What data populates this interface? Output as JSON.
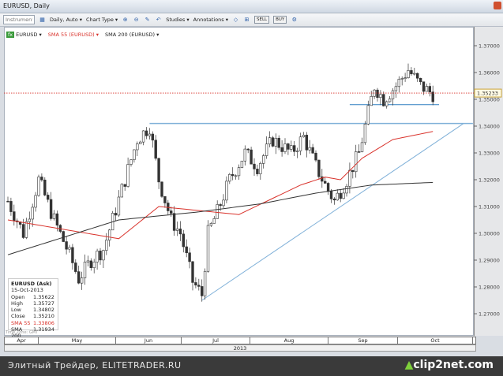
{
  "window": {
    "title": "EURUSD, Daily"
  },
  "toolbar": {
    "instrument_placeholder": "Instrument",
    "period": "Daily, Auto ▾",
    "chart_type": "Chart Type ▾",
    "studies": "Studies ▾",
    "annotations": "Annotations ▾",
    "sell": "SELL",
    "buy": "BUY"
  },
  "legend": {
    "symbol": "EURUSD ▾",
    "sma55": "SMA 55 (EURUSD) ▾",
    "sma200": "SMA 200 (EURUSD) ▾"
  },
  "info": {
    "title": "EURUSD (Ask)",
    "date": "15-Oct-2013",
    "rows": [
      [
        "Open",
        "1.35622"
      ],
      [
        "High",
        "1.35727"
      ],
      [
        "Low",
        "1.34802"
      ],
      [
        "Close",
        "1.35210"
      ],
      [
        "SMA 55",
        "1.33806"
      ],
      [
        "SMA 200",
        "1.31934"
      ]
    ]
  },
  "time_zone": "Time Zone: GMT",
  "colors": {
    "sma55": "#d9322b",
    "sma200": "#333333",
    "trend": "#5b9bd5",
    "current": "#d9322b"
  },
  "chart_data": {
    "type": "candlestick",
    "symbol": "EURUSD",
    "timeframe": "Daily",
    "months": [
      "Apr",
      "May",
      "Jun",
      "Jul",
      "Aug",
      "Sep",
      "Oct"
    ],
    "year": "2013",
    "y_ticks": [
      "1.37000",
      "1.36000",
      "1.35000",
      "1.34000",
      "1.33000",
      "1.32000",
      "1.31000",
      "1.30000",
      "1.29000",
      "1.28000",
      "1.27000"
    ],
    "ylim": [
      1.262,
      1.378
    ],
    "current_price": "1.35233",
    "days": 138,
    "close_path": [
      [
        0,
        1.312
      ],
      [
        5,
        1.3
      ],
      [
        10,
        1.32
      ],
      [
        15,
        1.305
      ],
      [
        20,
        1.292
      ],
      [
        23,
        1.283
      ],
      [
        27,
        1.29
      ],
      [
        31,
        1.294
      ],
      [
        38,
        1.32
      ],
      [
        42,
        1.335
      ],
      [
        46,
        1.34
      ],
      [
        49,
        1.32
      ],
      [
        53,
        1.305
      ],
      [
        56,
        1.3
      ],
      [
        60,
        1.282
      ],
      [
        63,
        1.277
      ],
      [
        65,
        1.3
      ],
      [
        68,
        1.308
      ],
      [
        72,
        1.32
      ],
      [
        77,
        1.33
      ],
      [
        81,
        1.325
      ],
      [
        86,
        1.335
      ],
      [
        92,
        1.33
      ],
      [
        96,
        1.336
      ],
      [
        100,
        1.325
      ],
      [
        103,
        1.318
      ],
      [
        106,
        1.312
      ],
      [
        110,
        1.32
      ],
      [
        114,
        1.33
      ],
      [
        117,
        1.345
      ],
      [
        119,
        1.355
      ],
      [
        122,
        1.35
      ],
      [
        126,
        1.355
      ],
      [
        130,
        1.361
      ],
      [
        134,
        1.355
      ],
      [
        138,
        1.352
      ]
    ],
    "sma55": [
      [
        0,
        1.305
      ],
      [
        36,
        1.298
      ],
      [
        49,
        1.31
      ],
      [
        75,
        1.307
      ],
      [
        95,
        1.318
      ],
      [
        103,
        1.321
      ],
      [
        108,
        1.32
      ],
      [
        115,
        1.328
      ],
      [
        125,
        1.335
      ],
      [
        138,
        1.338
      ]
    ],
    "sma200": [
      [
        0,
        1.292
      ],
      [
        36,
        1.305
      ],
      [
        62,
        1.308
      ],
      [
        82,
        1.311
      ],
      [
        100,
        1.315
      ],
      [
        118,
        1.318
      ],
      [
        138,
        1.319
      ]
    ],
    "trendlines": [
      {
        "from": [
          63,
          1.275
        ],
        "to": [
          148,
          1.341
        ]
      },
      {
        "from": [
          46,
          1.341
        ],
        "to": [
          151,
          1.341
        ]
      },
      {
        "from": [
          111,
          1.348
        ],
        "to": [
          140,
          1.348
        ]
      }
    ]
  }
}
